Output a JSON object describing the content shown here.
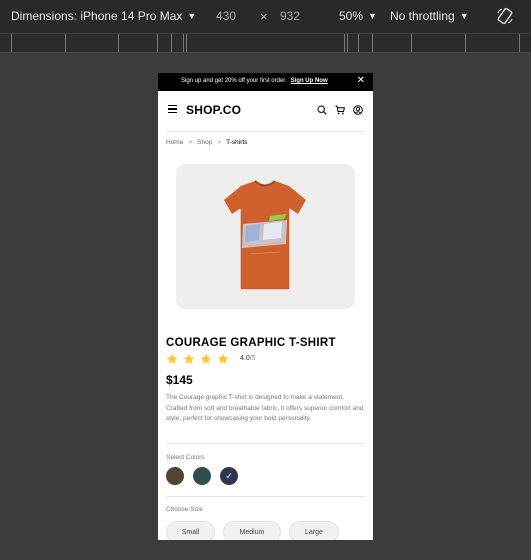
{
  "devtools": {
    "dimensions_label": "Dimensions: iPhone 14 Pro Max",
    "width": "430",
    "times": "×",
    "height": "932",
    "zoom": "50%",
    "throttling": "No throttling"
  },
  "promo": {
    "text": "Sign up and get 20% off your first order.",
    "link": "Sign Up Now",
    "close": "✕"
  },
  "nav": {
    "logo": "SHOP.CO"
  },
  "breadcrumb": {
    "home": "Home",
    "shop": "Shop",
    "current": "T-shirts",
    "sep": ">"
  },
  "product": {
    "title": "COURAGE GRAPHIC T-SHIRT",
    "rating": "4.0",
    "rating_max": "/5",
    "price": "$145",
    "description": "The Courage graphic T-shirt is designed to make a statement. Crafted from soft and breathable fabric, it offers superior comfort and style, perfect for showcasing your bold personality.",
    "stars": 4
  },
  "colors": {
    "label": "Select Colors",
    "swatches": [
      "#4f4631",
      "#314f4a",
      "#31344f"
    ],
    "selected_check": "✓"
  },
  "sizes": {
    "label": "Choose Size",
    "options": [
      "Small",
      "Medium",
      "Large"
    ]
  }
}
